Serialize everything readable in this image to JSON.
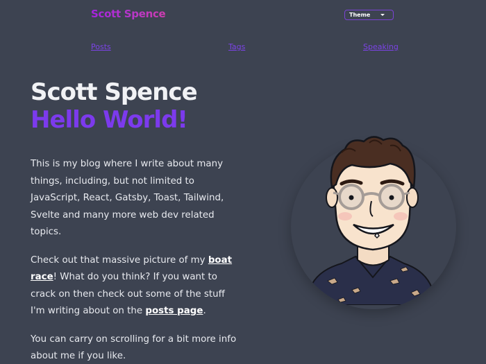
{
  "header": {
    "site_title": "Scott Spence",
    "theme_select": {
      "selected": "Theme"
    }
  },
  "nav": {
    "items": [
      {
        "label": "Posts"
      },
      {
        "label": "Tags"
      },
      {
        "label": "Speaking"
      }
    ]
  },
  "hero": {
    "title_line1": "Scott Spence",
    "title_line2": "Hello World!"
  },
  "intro": {
    "p1": "This is my blog where I write about many things, including, but not limited to JavaScript, React, Gatsby, Toast, Tailwind, Svelte and many more web dev related topics.",
    "p2_before": "Check out that massive picture of my ",
    "p2_link1": "boat race",
    "p2_middle": "! What do you think? If you want to crack on then check out some of the stuff I'm writing about on the ",
    "p2_link2": "posts page",
    "p2_after": ".",
    "p3": "You can carry on scrolling for a bit more info about me if you like."
  },
  "colors": {
    "background": "#3d4351",
    "accent": "#7c3aed",
    "link": "#7c43e6"
  }
}
